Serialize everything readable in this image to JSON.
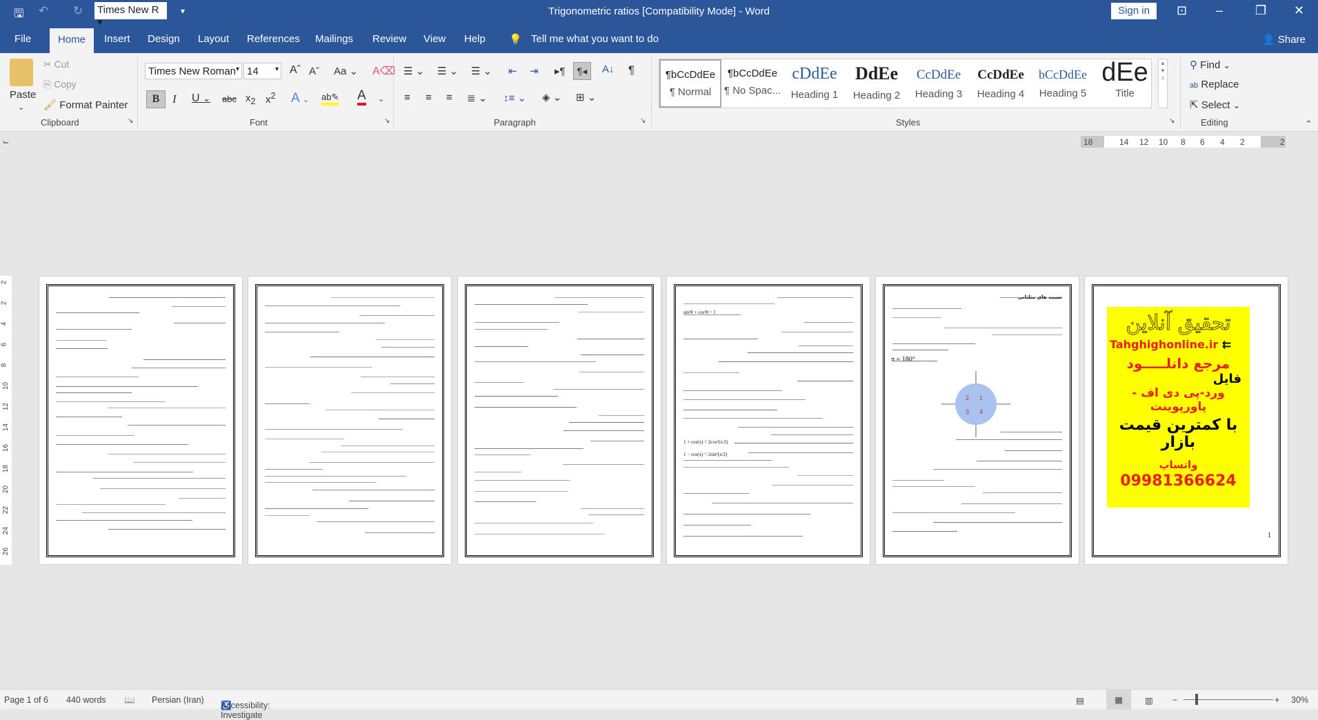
{
  "titlebar": {
    "font_box": "Times New R",
    "title": "Trigonometric ratios [Compatibility Mode]  -  Word",
    "sign_in": "Sign in"
  },
  "tabs": [
    "File",
    "Home",
    "Insert",
    "Design",
    "Layout",
    "References",
    "Mailings",
    "Review",
    "View",
    "Help"
  ],
  "active_tab": "Home",
  "tell_me": "Tell me what you want to do",
  "share": "Share",
  "clipboard": {
    "paste": "Paste",
    "cut": "Cut",
    "copy": "Copy",
    "format_painter": "Format Painter",
    "group": "Clipboard"
  },
  "font": {
    "name": "Times New Roman",
    "size": "14",
    "group": "Font",
    "font_color": "#e81123",
    "highlight_color": "#ffff00"
  },
  "paragraph": {
    "group": "Paragraph"
  },
  "styles": {
    "group": "Styles",
    "items": [
      {
        "preview": "¶bCcDdEe",
        "name": "¶ Normal"
      },
      {
        "preview": "¶bCcDdEe",
        "name": "¶ No Spac..."
      },
      {
        "preview": "cDdEe",
        "name": "Heading 1"
      },
      {
        "preview": "DdEe",
        "name": "Heading 2"
      },
      {
        "preview": "CcDdEe",
        "name": "Heading 3"
      },
      {
        "preview": "CcDdEe",
        "name": "Heading 4"
      },
      {
        "preview": "bCcDdEe",
        "name": "Heading 5"
      },
      {
        "preview": "dEe",
        "name": "Title"
      }
    ]
  },
  "editing": {
    "find": "Find",
    "replace": "Replace",
    "select": "Select",
    "group": "Editing"
  },
  "ruler": {
    "numbers": [
      "18",
      "14",
      "12",
      "10",
      "8",
      "6",
      "4",
      "2",
      "2"
    ]
  },
  "vruler": {
    "numbers": [
      "2",
      "2",
      "4",
      "6",
      "8",
      "10",
      "12",
      "14",
      "16",
      "18",
      "20",
      "22",
      "24",
      "26"
    ]
  },
  "pages": {
    "p5": {
      "heading": "نسبت های مثلثاتی",
      "formula": "π = 180°"
    },
    "p3": {
      "formula1": "sin²θ + cos²θ = 1",
      "formula2": "1 + cos(x) = 2cos²(x/2)",
      "formula3": "1 − cos(x) = 2sin²(x/2)"
    },
    "ad": {
      "title": "تحقیق آنلاین",
      "site": "Tahghighonline.ir",
      "line1": "مرجع دانلـــــود",
      "line2": "فایل",
      "line3": "ورد-پی دی اف - پاورپوینت",
      "line4": "با کمترین قیمت بازار",
      "phone": "09981366624",
      "whatsapp": "واتساپ",
      "page_mark": "1"
    }
  },
  "status": {
    "page": "Page 1 of 6",
    "words": "440 words",
    "language": "Persian (Iran)",
    "accessibility": "Accessibility: Investigate",
    "zoom": "30%"
  }
}
